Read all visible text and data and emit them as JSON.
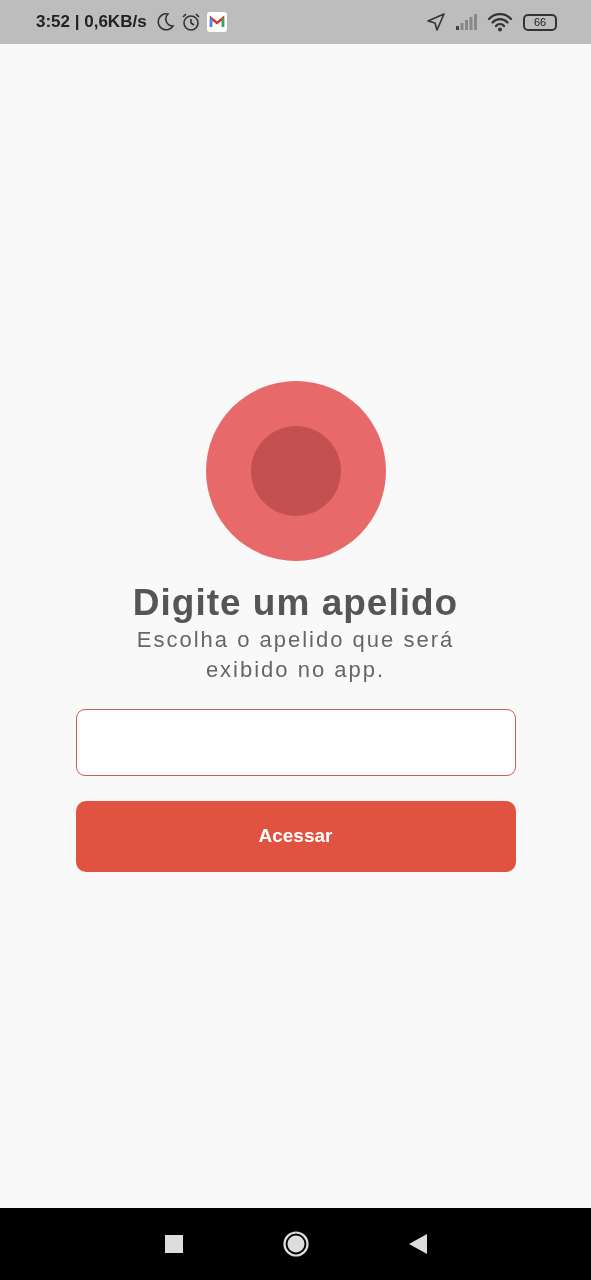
{
  "status_bar": {
    "time_and_speed": "3:52 | 0,6KB/s",
    "battery": "66"
  },
  "title": "Digite um apelido",
  "subtitle": "Escolha o apelido que será exibido no app.",
  "button": "Acessar"
}
